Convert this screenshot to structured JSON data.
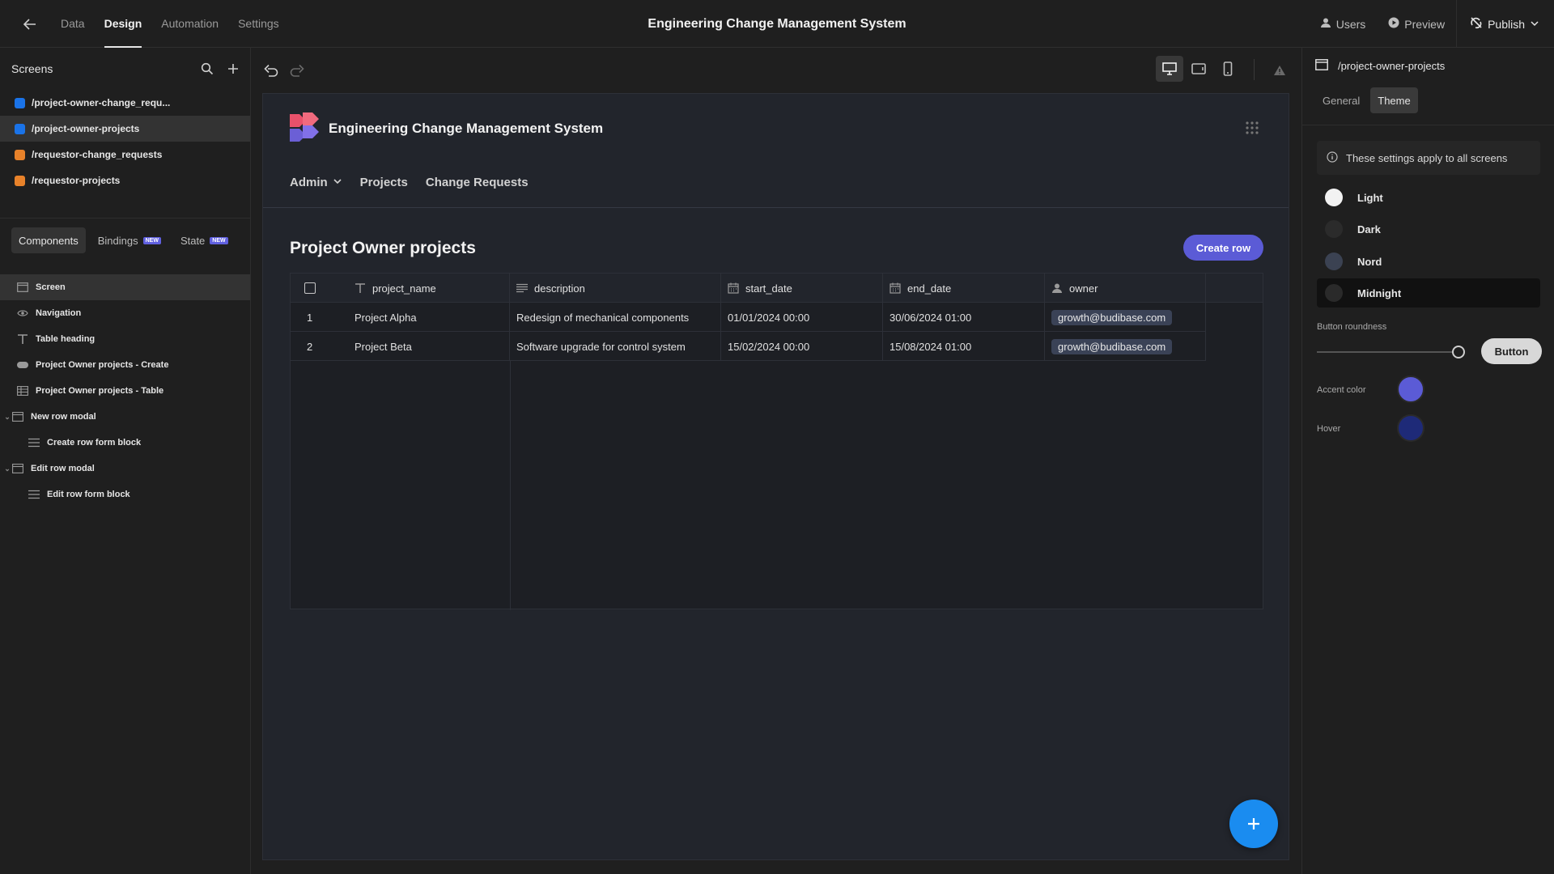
{
  "topbar": {
    "tabs": [
      "Data",
      "Design",
      "Automation",
      "Settings"
    ],
    "app_title": "Engineering Change Management System",
    "users_label": "Users",
    "preview_label": "Preview",
    "publish_label": "Publish"
  },
  "sidebar": {
    "screens_title": "Screens",
    "screens": [
      {
        "path": "/project-owner-change_requ...",
        "color": "#1a73e8"
      },
      {
        "path": "/project-owner-projects",
        "color": "#1a73e8"
      },
      {
        "path": "/requestor-change_requests",
        "color": "#e8822a"
      },
      {
        "path": "/requestor-projects",
        "color": "#e8822a"
      }
    ],
    "tabs": {
      "components": "Components",
      "bindings": "Bindings",
      "state": "State",
      "new_badge": "NEW"
    },
    "tree": [
      {
        "label": "Screen",
        "icon": "screen-icon"
      },
      {
        "label": "Navigation",
        "icon": "eye-icon"
      },
      {
        "label": "Table heading",
        "icon": "text-icon"
      },
      {
        "label": "Project Owner projects - Create",
        "icon": "button-icon"
      },
      {
        "label": "Project Owner projects - Table",
        "icon": "table-icon"
      },
      {
        "label": "New row modal",
        "icon": "modal-icon"
      },
      {
        "label": "Create row form block",
        "icon": "form-icon"
      },
      {
        "label": "Edit row modal",
        "icon": "modal-icon"
      },
      {
        "label": "Edit row form block",
        "icon": "form-icon"
      }
    ]
  },
  "preview": {
    "brand": "Engineering Change Management System",
    "nav": [
      "Admin",
      "Projects",
      "Change Requests"
    ],
    "page_title": "Project Owner projects",
    "create_button": "Create row",
    "table": {
      "columns": [
        "project_name",
        "description",
        "start_date",
        "end_date",
        "owner"
      ],
      "rows": [
        {
          "index": "1",
          "project_name": "Project Alpha",
          "description": "Redesign of mechanical components",
          "start_date": "01/01/2024 00:00",
          "end_date": "30/06/2024 01:00",
          "owner": "growth@budibase.com"
        },
        {
          "index": "2",
          "project_name": "Project Beta",
          "description": "Software upgrade for control system",
          "start_date": "15/02/2024 00:00",
          "end_date": "15/08/2024 01:00",
          "owner": "growth@budibase.com"
        }
      ]
    }
  },
  "right_panel": {
    "screen_path": "/project-owner-projects",
    "tabs": [
      "General",
      "Theme"
    ],
    "info": "These settings apply to all screens",
    "themes": [
      {
        "label": "Light",
        "color": "#f2f2f2"
      },
      {
        "label": "Dark",
        "color": "#2b2b2b"
      },
      {
        "label": "Nord",
        "color": "#3b4252"
      },
      {
        "label": "Midnight",
        "color": "#2a2a2a"
      }
    ],
    "button_roundness_label": "Button roundness",
    "button_preview": "Button",
    "accent_label": "Accent color",
    "accent_color": "#5b5bd6",
    "hover_label": "Hover",
    "hover_color": "#1e2a78"
  }
}
